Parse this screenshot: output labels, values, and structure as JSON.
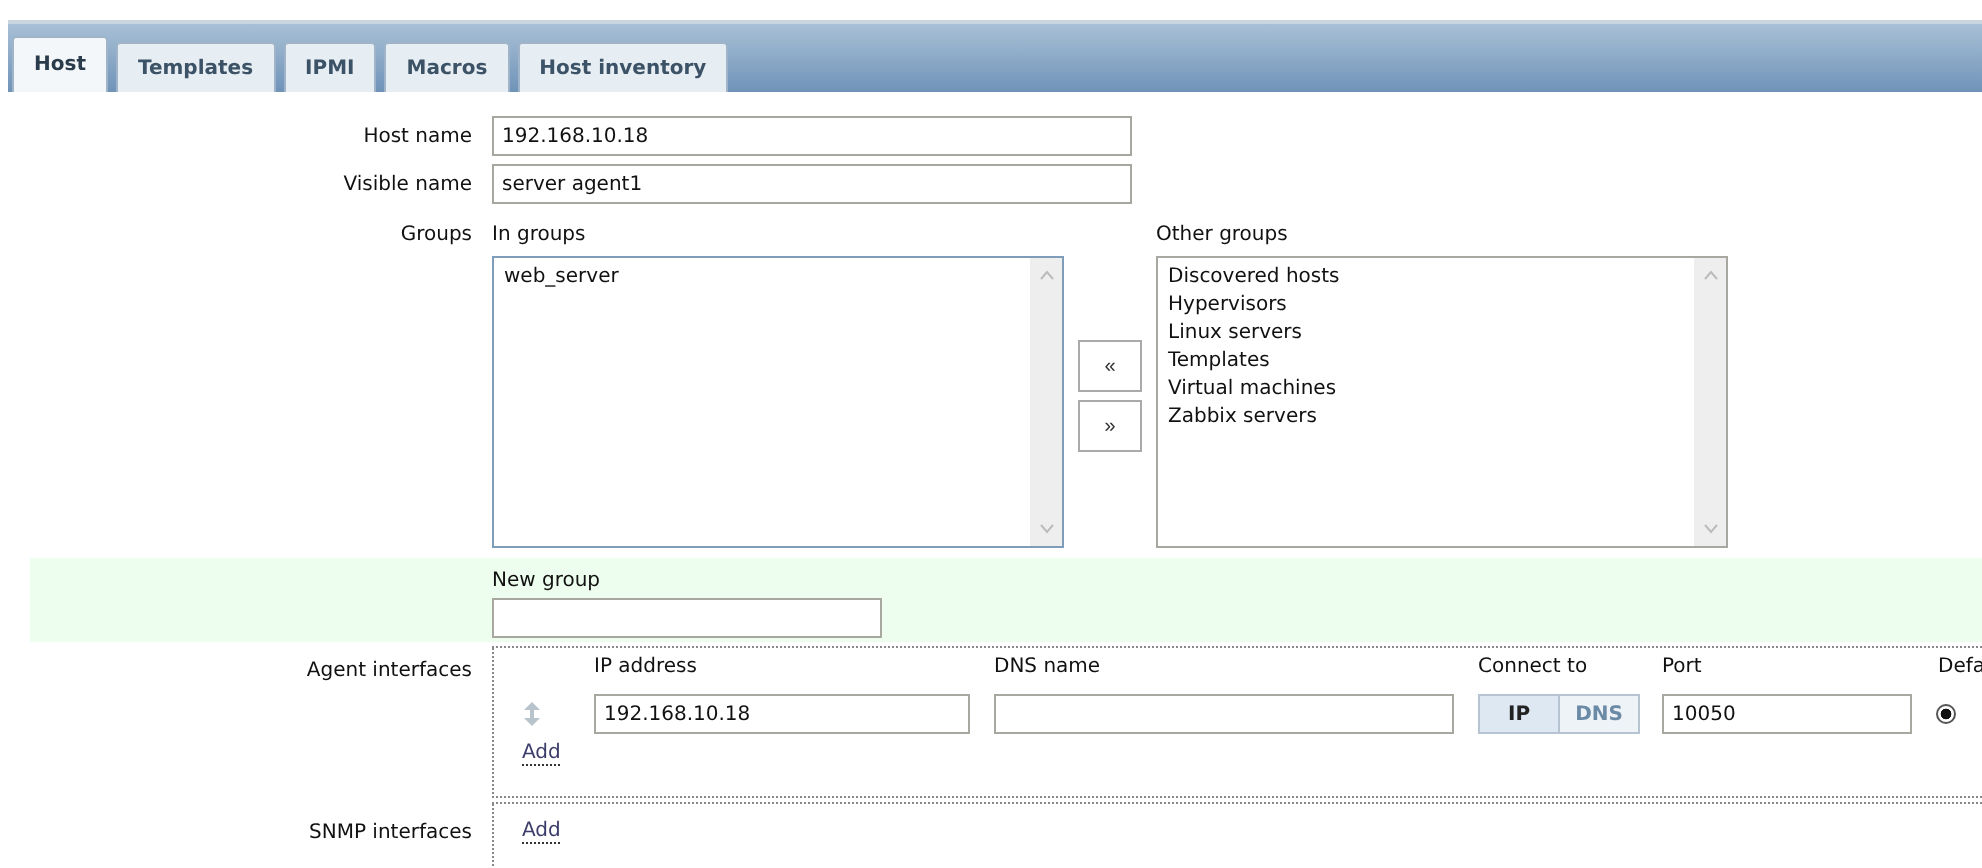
{
  "tabs": [
    {
      "label": "Host",
      "selected": true
    },
    {
      "label": "Templates",
      "selected": false
    },
    {
      "label": "IPMI",
      "selected": false
    },
    {
      "label": "Macros",
      "selected": false
    },
    {
      "label": "Host inventory",
      "selected": false
    }
  ],
  "host_name": {
    "label": "Host name",
    "value": "192.168.10.18"
  },
  "visible_name": {
    "label": "Visible name",
    "value": "server agent1"
  },
  "groups": {
    "label": "Groups",
    "in_groups_label": "In groups",
    "in_groups": [
      "web_server"
    ],
    "move_left": "«",
    "move_right": "»",
    "other_groups_label": "Other groups",
    "other_groups": [
      "Discovered hosts",
      "Hypervisors",
      "Linux servers",
      "Templates",
      "Virtual machines",
      "Zabbix servers"
    ]
  },
  "new_group": {
    "label": "New group"
  },
  "agent_interfaces": {
    "label": "Agent interfaces",
    "columns": [
      "IP address",
      "DNS name",
      "Connect to",
      "Port",
      "Defa"
    ],
    "rows": [
      {
        "ip": "192.168.10.18",
        "connect_options": [
          {
            "label": "IP",
            "selected": true
          },
          {
            "label": "DNS",
            "selected": false
          }
        ],
        "port": "10050",
        "default": true
      }
    ],
    "add": "Add"
  },
  "snmp_interfaces": {
    "label": "SNMP interfaces",
    "add": "Add"
  }
}
